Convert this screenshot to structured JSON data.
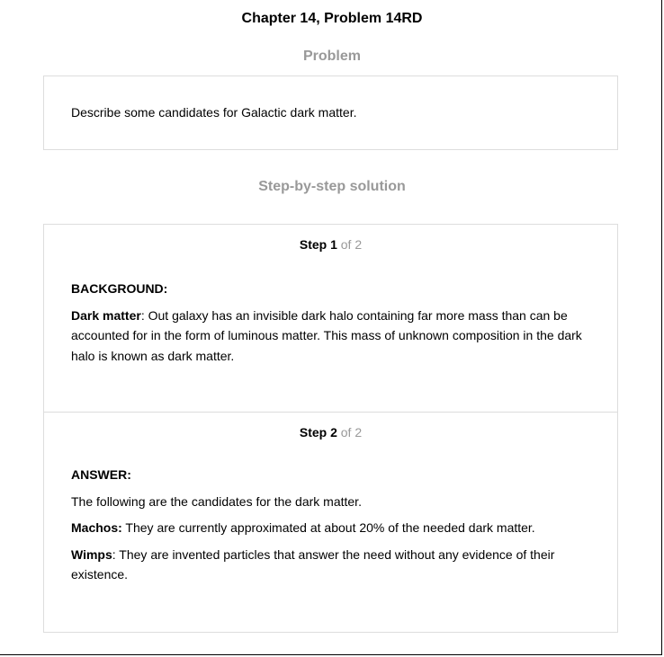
{
  "document": {
    "title": "Chapter 14, Problem 14RD"
  },
  "problem": {
    "heading": "Problem",
    "text": "Describe some candidates for Galactic dark matter."
  },
  "solution": {
    "heading": "Step-by-step solution",
    "steps": [
      {
        "step_label": "Step 1",
        "of_label": " of 2",
        "section_label": "BACKGROUND:",
        "paragraphs": [
          {
            "term": "Dark matter",
            "text": ": Out galaxy has an invisible dark halo containing far more mass than can be accounted for in the form of luminous matter. This mass of unknown composition in the dark halo is known as dark matter."
          }
        ]
      },
      {
        "step_label": "Step 2",
        "of_label": " of 2",
        "section_label": "ANSWER:",
        "intro": "The following are the candidates for the dark matter.",
        "paragraphs": [
          {
            "term": "Machos:",
            "text": " They are currently approximated at about 20% of the needed dark matter."
          },
          {
            "term": "Wimps",
            "text": ": They are invented particles that answer the need without any evidence of their existence."
          }
        ]
      }
    ]
  }
}
